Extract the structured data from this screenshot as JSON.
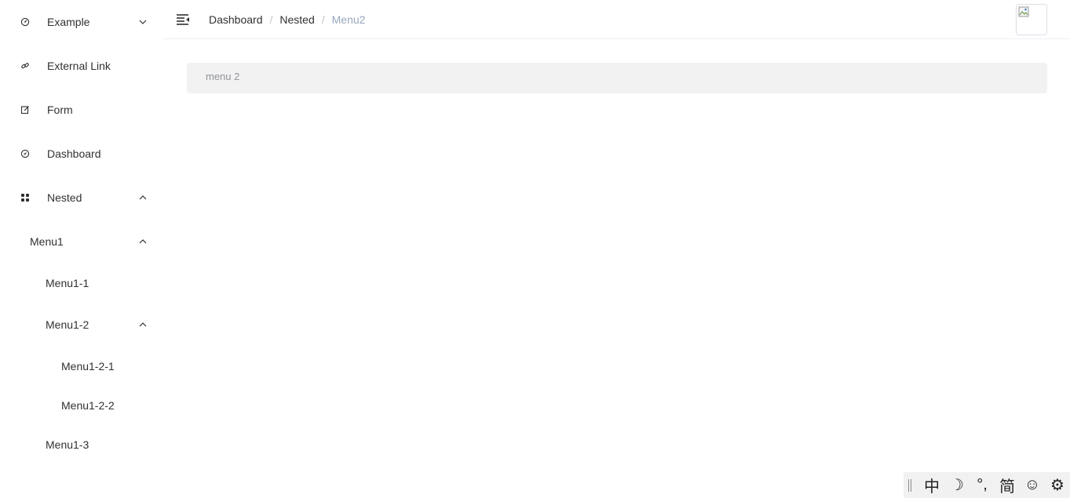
{
  "sidebar": {
    "items": [
      {
        "label": "Example",
        "icon": "gauge-icon"
      },
      {
        "label": "External Link",
        "icon": "link-icon"
      },
      {
        "label": "Form",
        "icon": "edit-icon"
      },
      {
        "label": "Dashboard",
        "icon": "compass-icon"
      },
      {
        "label": "Nested",
        "icon": "grid-icon"
      }
    ],
    "nested": {
      "menu1": "Menu1",
      "menu1_1": "Menu1-1",
      "menu1_2": "Menu1-2",
      "menu1_2_1": "Menu1-2-1",
      "menu1_2_2": "Menu1-2-2",
      "menu1_3": "Menu1-3"
    }
  },
  "navbar": {
    "breadcrumb": [
      "Dashboard",
      "Nested",
      "Menu2"
    ],
    "separator": "/"
  },
  "main": {
    "panel_text": "menu 2"
  },
  "ime_toolbar": {
    "buttons": [
      "中",
      "☽",
      "°,",
      "简",
      "☺",
      "⚙"
    ]
  },
  "colors": {
    "text": "#303133",
    "breadcrumb_last": "#97a8be",
    "panel_bg": "#f2f2f2",
    "panel_text": "#909399"
  }
}
